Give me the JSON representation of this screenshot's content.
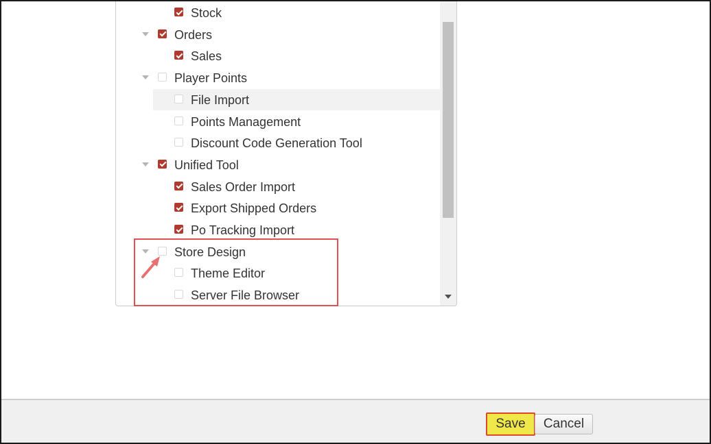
{
  "tree": {
    "items": [
      {
        "label": "Stock",
        "level": 1,
        "checked": true,
        "expandable": false
      },
      {
        "label": "Orders",
        "level": 0,
        "checked": true,
        "expandable": true
      },
      {
        "label": "Sales",
        "level": 1,
        "checked": true,
        "expandable": false
      },
      {
        "label": "Player Points",
        "level": 0,
        "checked": false,
        "expandable": true
      },
      {
        "label": "File Import",
        "level": 1,
        "checked": false,
        "expandable": false,
        "highlighted": true
      },
      {
        "label": "Points Management",
        "level": 1,
        "checked": false,
        "expandable": false
      },
      {
        "label": "Discount Code Generation Tool",
        "level": 1,
        "checked": false,
        "expandable": false
      },
      {
        "label": "Unified Tool",
        "level": 0,
        "checked": true,
        "expandable": true
      },
      {
        "label": "Sales Order Import",
        "level": 1,
        "checked": true,
        "expandable": false
      },
      {
        "label": "Export Shipped Orders",
        "level": 1,
        "checked": true,
        "expandable": false
      },
      {
        "label": "Po Tracking Import",
        "level": 1,
        "checked": true,
        "expandable": false
      },
      {
        "label": "Store Design",
        "level": 0,
        "checked": false,
        "expandable": true
      },
      {
        "label": "Theme Editor",
        "level": 1,
        "checked": false,
        "expandable": false
      },
      {
        "label": "Server File Browser",
        "level": 1,
        "checked": false,
        "expandable": false
      }
    ]
  },
  "footer": {
    "save_label": "Save",
    "cancel_label": "Cancel"
  },
  "colors": {
    "checkbox_checked": "#b03a2e",
    "annotation": "#e05252",
    "save_highlight": "#f0e84a"
  }
}
